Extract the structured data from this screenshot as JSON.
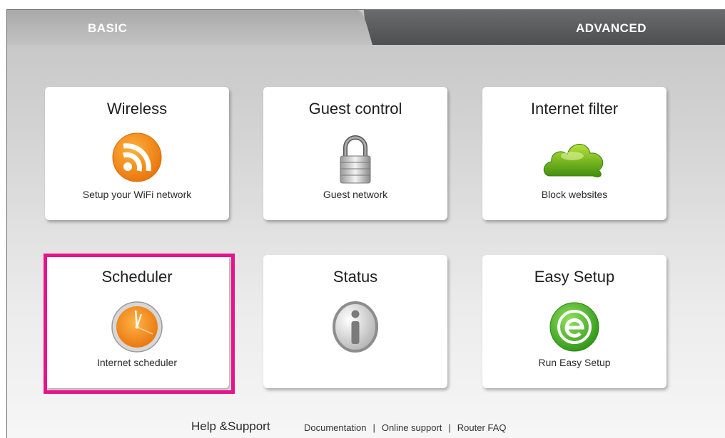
{
  "tabs": {
    "basic": "BASIC",
    "advanced": "ADVANCED"
  },
  "cards": [
    {
      "title": "Wireless",
      "subtitle": "Setup your WiFi network",
      "icon": "rss-wifi-icon"
    },
    {
      "title": "Guest control",
      "subtitle": "Guest network",
      "icon": "padlock-icon"
    },
    {
      "title": "Internet filter",
      "subtitle": "Block websites",
      "icon": "cloud-icon"
    },
    {
      "title": "Scheduler",
      "subtitle": "Internet scheduler",
      "icon": "clock-icon"
    },
    {
      "title": "Status",
      "subtitle": "",
      "icon": "info-icon"
    },
    {
      "title": "Easy Setup",
      "subtitle": "Run Easy Setup",
      "icon": "easy-setup-icon"
    }
  ],
  "footer": {
    "help": "Help &Support",
    "links": [
      "Documentation",
      "Online support",
      "Router FAQ"
    ],
    "separator": "|"
  },
  "colors": {
    "highlight": "#e6138c",
    "advanced_tab": "#58595b",
    "basic_tab": "#b9b9b9"
  }
}
